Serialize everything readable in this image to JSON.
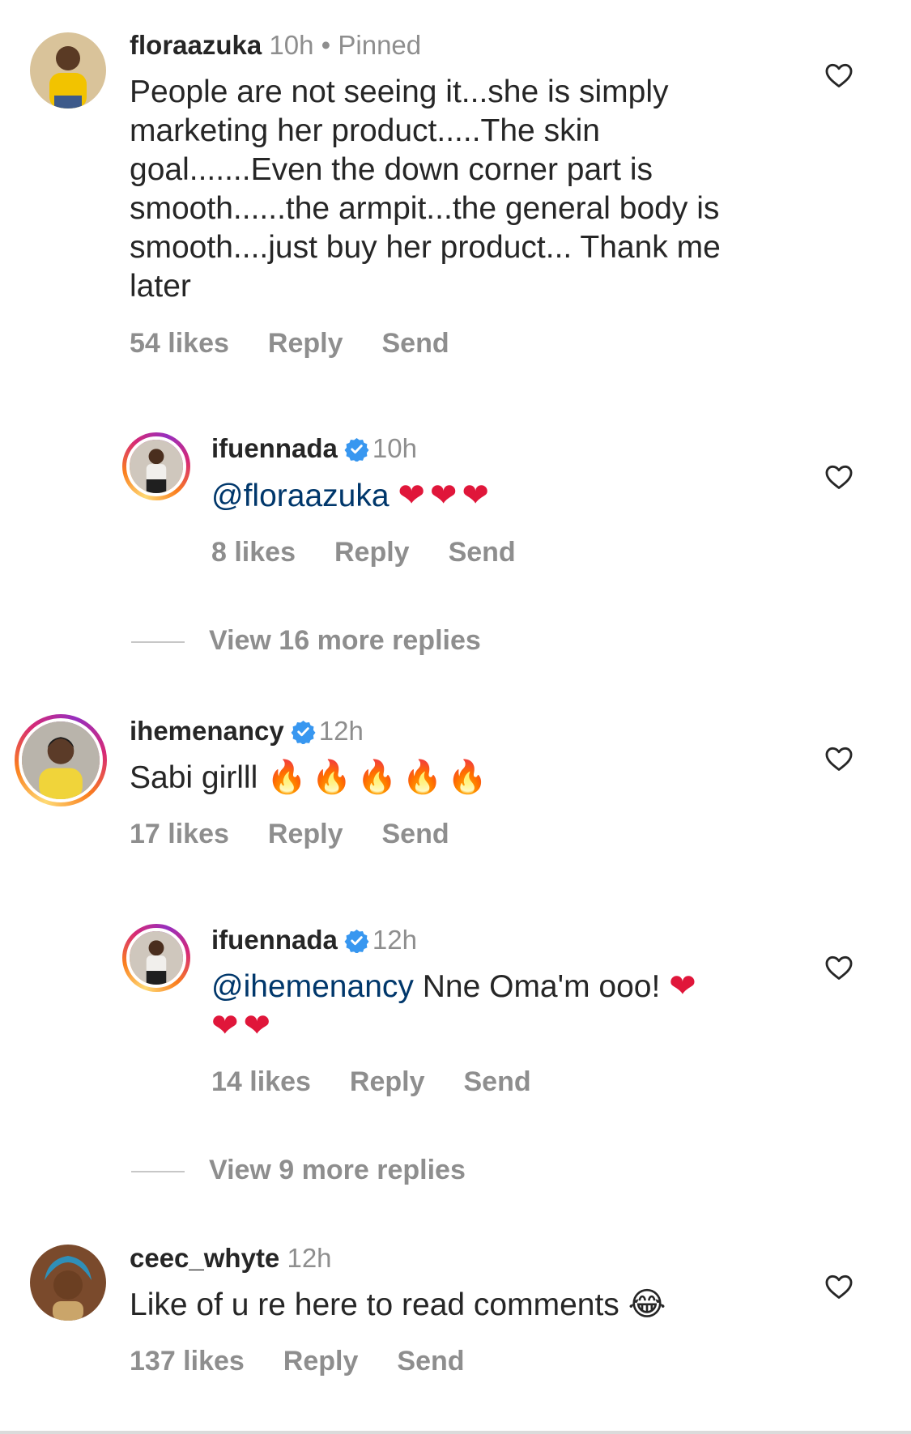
{
  "comments": [
    {
      "username": "floraazuka",
      "time": "10h",
      "pinned": "Pinned",
      "text": "People are not seeing it...she is simply marketing her product.....The skin goal.......Even the down corner part is smooth......the armpit...the general body is smooth....just buy her product... Thank me later",
      "likes": "54 likes",
      "reply": "Reply",
      "send": "Send"
    },
    {
      "username": "ifuennada",
      "time": "10h",
      "mention": "@floraazuka",
      "emoji": "❤❤❤",
      "likes": "8 likes",
      "reply": "Reply",
      "send": "Send"
    },
    {
      "username": "ihemenancy",
      "time": "12h",
      "text": "Sabi girlll",
      "emoji": "🔥🔥🔥🔥🔥",
      "likes": "17 likes",
      "reply": "Reply",
      "send": "Send"
    },
    {
      "username": "ifuennada",
      "time": "12h",
      "mention": "@ihemenancy",
      "text": "Nne Oma'm ooo!",
      "emoji_line1": "❤",
      "emoji_line2": "❤❤",
      "likes": "14 likes",
      "reply": "Reply",
      "send": "Send"
    },
    {
      "username": "ceec_whyte",
      "time": "12h",
      "text": "Like of u re here to read comments",
      "emoji": "😂",
      "likes": "137 likes",
      "reply": "Reply",
      "send": "Send"
    }
  ],
  "view_more": [
    "View 16 more replies",
    "View 9 more replies"
  ],
  "dot": "•",
  "colors": {
    "text": "#262626",
    "secondary": "#8e8e8e",
    "mention": "#00376b",
    "verified": "#3897f0",
    "heart_emoji": "#e0163a"
  },
  "icons": {
    "like": "heart-outline-icon",
    "verified": "verified-badge-icon"
  }
}
